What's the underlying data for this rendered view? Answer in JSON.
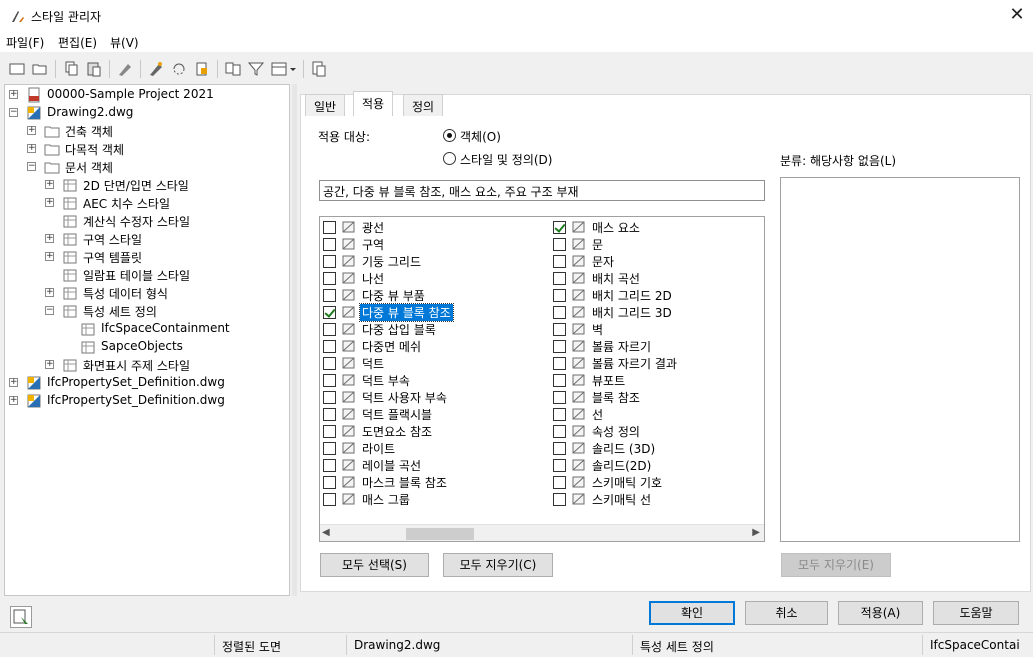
{
  "window": {
    "title": "스타일 관리자",
    "close_glyph": "✕"
  },
  "menu": [
    "파일(F)",
    "편집(E)",
    "뷰(V)"
  ],
  "toolbar": [
    "new-icon",
    "open-icon",
    "copy-icon",
    "paste-icon",
    "purge-icon",
    "edit-icon",
    "sync-icon",
    "warning-icon",
    "compare-icon",
    "filter-icon",
    "view-icon",
    "help-icon"
  ],
  "tree": [
    {
      "label": "00000-Sample Project 2021",
      "level": 0,
      "exp": "+"
    },
    {
      "label": "Drawing2.dwg",
      "level": 0,
      "exp": "−"
    },
    {
      "label": "건축 객체",
      "level": 1,
      "exp": "+"
    },
    {
      "label": "다목적 객체",
      "level": 1,
      "exp": "+"
    },
    {
      "label": "문서 객체",
      "level": 1,
      "exp": "−"
    },
    {
      "label": "2D 단면/입면 스타일",
      "level": 2,
      "exp": "+"
    },
    {
      "label": "AEC 치수 스타일",
      "level": 2,
      "exp": "+"
    },
    {
      "label": "계산식 수정자 스타일",
      "level": 2,
      "exp": ""
    },
    {
      "label": "구역 스타일",
      "level": 2,
      "exp": "+"
    },
    {
      "label": "구역 템플릿",
      "level": 2,
      "exp": "+"
    },
    {
      "label": "일람표 테이블 스타일",
      "level": 2,
      "exp": ""
    },
    {
      "label": "특성 데이터 형식",
      "level": 2,
      "exp": "+"
    },
    {
      "label": "특성 세트 정의",
      "level": 2,
      "exp": "−"
    },
    {
      "label": "IfcSpaceContainment",
      "level": 3,
      "exp": "",
      "selected": true
    },
    {
      "label": "SapceObjects",
      "level": 3,
      "exp": ""
    },
    {
      "label": "화면표시 주제 스타일",
      "level": 2,
      "exp": "+"
    },
    {
      "label": "IfcPropertySet_Definition.dwg",
      "level": 0,
      "exp": "+"
    },
    {
      "label": "IfcPropertySet_Definition.dwg",
      "level": 0,
      "exp": "+"
    }
  ],
  "tabs": [
    "일반",
    "적용",
    "정의"
  ],
  "apply": {
    "label": "적용 대상:",
    "option_objects": "객체(O)",
    "option_styles": "스타일 및 정의(D)",
    "summary": "공간, 다중 뷰 블록 참조, 매스 요소, 주요 구조 부재"
  },
  "items_left": [
    {
      "label": "광선",
      "checked": false
    },
    {
      "label": "구역",
      "checked": false
    },
    {
      "label": "기둥 그리드",
      "checked": false
    },
    {
      "label": "나선",
      "checked": false
    },
    {
      "label": "다중 뷰 부품",
      "checked": false
    },
    {
      "label": "다중 뷰 블록 참조",
      "checked": true,
      "highlight": true
    },
    {
      "label": "다중 삽입 블록",
      "checked": false
    },
    {
      "label": "다중면 메쉬",
      "checked": false
    },
    {
      "label": "덕트",
      "checked": false
    },
    {
      "label": "덕트 부속",
      "checked": false
    },
    {
      "label": "덕트 사용자 부속",
      "checked": false
    },
    {
      "label": "덕트 플랙시블",
      "checked": false
    },
    {
      "label": "도면요소 참조",
      "checked": false
    },
    {
      "label": "라이트",
      "checked": false
    },
    {
      "label": "레이블 곡선",
      "checked": false
    },
    {
      "label": "마스크 블록 참조",
      "checked": false
    },
    {
      "label": "매스 그룹",
      "checked": false
    }
  ],
  "items_right": [
    {
      "label": "매스 요소",
      "checked": true
    },
    {
      "label": "문",
      "checked": false
    },
    {
      "label": "문자",
      "checked": false
    },
    {
      "label": "배치 곡선",
      "checked": false
    },
    {
      "label": "배치 그리드 2D",
      "checked": false
    },
    {
      "label": "배치 그리드 3D",
      "checked": false
    },
    {
      "label": "벽",
      "checked": false
    },
    {
      "label": "볼륨 자르기",
      "checked": false
    },
    {
      "label": "볼륨 자르기 결과",
      "checked": false
    },
    {
      "label": "뷰포트",
      "checked": false
    },
    {
      "label": "블록 참조",
      "checked": false
    },
    {
      "label": "선",
      "checked": false
    },
    {
      "label": "속성 정의",
      "checked": false
    },
    {
      "label": "솔리드 (3D)",
      "checked": false
    },
    {
      "label": "솔리드(2D)",
      "checked": false
    },
    {
      "label": "스키매틱 기호",
      "checked": false
    },
    {
      "label": "스키매틱 선",
      "checked": false
    }
  ],
  "buttons": {
    "select_all": "모두 선택(S)",
    "clear_all": "모두 지우기(C)",
    "clear_all_right": "모두 지우기(E)",
    "ok": "확인",
    "cancel": "취소",
    "apply": "적용(A)",
    "help": "도움말"
  },
  "classification": {
    "label": "분류: 해당사항 없음(L)"
  },
  "status": [
    "정렬된 도면",
    "Drawing2.dwg",
    "특성 세트 정의",
    "IfcSpaceContain"
  ]
}
